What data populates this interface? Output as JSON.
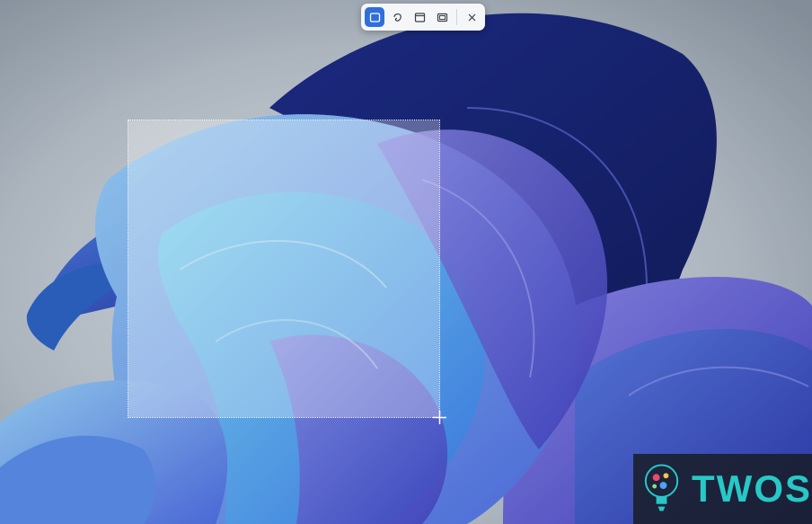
{
  "capture_toolbar": {
    "modes": [
      {
        "name": "rectangle-mode",
        "icon": "rectangle-snip-icon",
        "active": true
      },
      {
        "name": "freeform-mode",
        "icon": "freeform-snip-icon",
        "active": false
      },
      {
        "name": "window-mode",
        "icon": "window-snip-icon",
        "active": false
      },
      {
        "name": "fullscreen-mode",
        "icon": "fullscreen-snip-icon",
        "active": false
      }
    ],
    "close_icon": "close-icon"
  },
  "selection": {
    "cursor_icon": "crosshair-icon"
  },
  "watermark": {
    "text": "TWOS",
    "logo_icon": "lightbulb-logo"
  },
  "colors": {
    "accent": "#2f6fdc",
    "brand": "#27c8c6",
    "bloom": "#3b55d8"
  }
}
